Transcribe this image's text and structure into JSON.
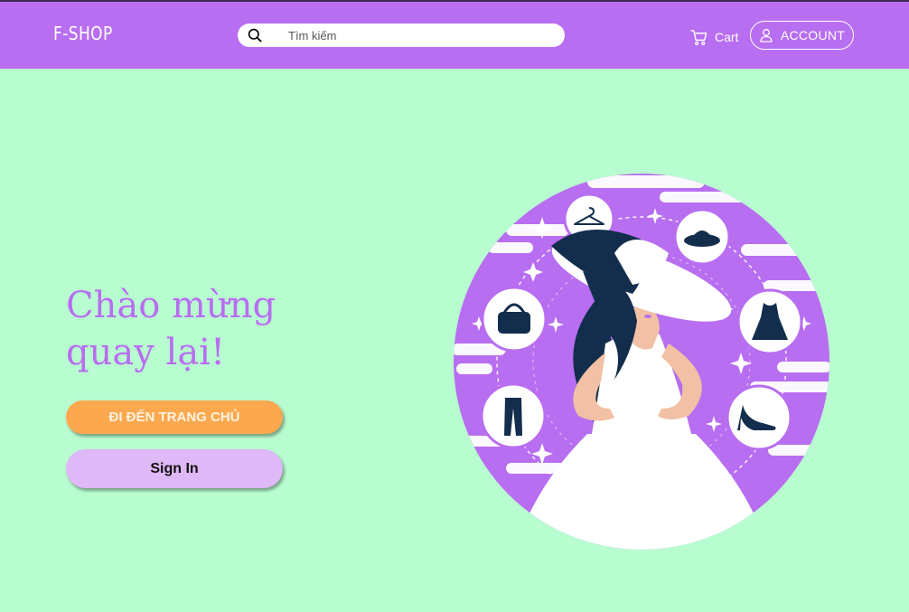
{
  "header": {
    "logo": "F-SHOP",
    "search": {
      "placeholder": "Tìm kiếm",
      "icon": "search-icon"
    },
    "cart_label": "Cart",
    "account_label": "ACCOUNT"
  },
  "hero": {
    "line1": "Chào mừng",
    "line2": "quay lại!",
    "home_button": "ĐI ĐẾN TRANG CHỦ",
    "signin_button": "Sign In"
  },
  "illustration": {
    "icons": [
      "hanger-icon",
      "hat-icon",
      "handbag-icon",
      "dress-icon",
      "pants-icon",
      "high-heel-icon"
    ]
  },
  "colors": {
    "header": "#b86ef0",
    "background": "#b8fdd0",
    "title": "#b86ef0",
    "home_button": "#fba84f",
    "signin_button": "#dfb8f7",
    "navy": "#132d4d"
  }
}
